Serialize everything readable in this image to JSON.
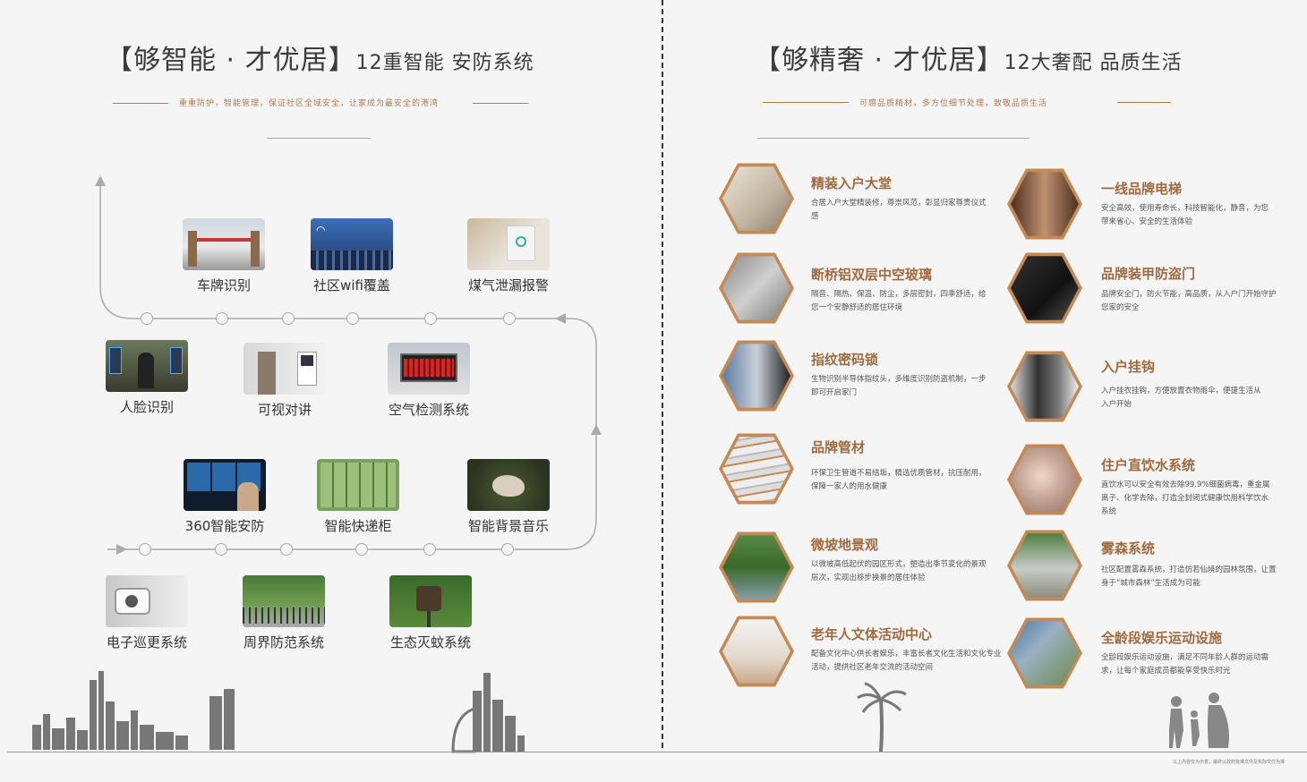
{
  "left": {
    "title_main": "【够智能 · 才优居】",
    "title_sub": "12重智能 安防系统",
    "tagline": "重重防护，智能管理，保证社区全域安全，让家成为最安全的港湾",
    "features": [
      {
        "label": "车牌识别",
        "icon": "license-plate-icon"
      },
      {
        "label": "社区wifi覆盖",
        "icon": "wifi-icon"
      },
      {
        "label": "煤气泄漏报警",
        "icon": "gas-alarm-icon"
      },
      {
        "label": "人脸识别",
        "icon": "face-recognition-icon"
      },
      {
        "label": "可视对讲",
        "icon": "video-intercom-icon"
      },
      {
        "label": "空气检测系统",
        "icon": "air-monitor-icon"
      },
      {
        "label": "360智能安防",
        "icon": "cctv-icon"
      },
      {
        "label": "智能快递柜",
        "icon": "parcel-locker-icon"
      },
      {
        "label": "智能背景音乐",
        "icon": "music-icon"
      },
      {
        "label": "电子巡更系统",
        "icon": "patrol-icon"
      },
      {
        "label": "周界防范系统",
        "icon": "perimeter-icon"
      },
      {
        "label": "生态灭蚊系统",
        "icon": "mosquito-killer-icon"
      }
    ]
  },
  "right": {
    "title_main": "【够精奢 · 才优居】",
    "title_sub": "12大奢配 品质生活",
    "tagline": "可感品质精材，多方位细节处理，致敬品质生活",
    "items": [
      {
        "title": "精装入户大堂",
        "desc": "合居入户大堂精装修，尊崇风范，彰显归家尊贵仪式感"
      },
      {
        "title": "一线品牌电梯",
        "desc": "安全高效，使用寿命长，科技智能化，静音，为您带来省心、安全的生活体验"
      },
      {
        "title": "断桥铝双层中空玻璃",
        "desc": "隔音、隔热、保温、防尘，多层密封，四季舒适，给您一个安静舒适的居住环境"
      },
      {
        "title": "品牌装甲防盗门",
        "desc": "品牌安全门，防火节能，高品质，从入户门开始守护您家的安全"
      },
      {
        "title": "指纹密码锁",
        "desc": "生物识别半导体指纹头，多维度识别防盗机制，一步即可开启家门"
      },
      {
        "title": "入户挂钩",
        "desc": "入户挂衣挂钩，方便放置衣物雨伞，便捷生活从入户开始"
      },
      {
        "title": "品牌管材",
        "desc": "环保卫生管道不易结垢，精选优质管材，抗压耐用，保障一家人的用水健康"
      },
      {
        "title": "住户直饮水系统",
        "desc": "直饮水可以安全有效去除99.9%细菌病毒，重金属离子、化学去除，打造全封闭式健康饮用科学饮水系统"
      },
      {
        "title": "微坡地景观",
        "desc": "以微坡高低起伏的园区形式，塑造出季节变化的景观层次，实现出移步换景的居住体验"
      },
      {
        "title": "雾森系统",
        "desc": "社区配置雾森系统，打造仿若仙境的园林氛围，让置身于“城市森林”生活成为可能"
      },
      {
        "title": "老年人文体活动中心",
        "desc": "配备文化中心供长者娱乐，丰富长者文化生活和文化专业活动，提供社区老年交流的活动空间"
      },
      {
        "title": "全龄段娱乐运动设施",
        "desc": "全龄段娱乐运动设施，满足不同年龄人群的运动需求，让每个家庭成员都能享受快乐时光"
      }
    ],
    "footnote": "以上内容仅为示意，最终以政府批准文件及实际交付为准"
  },
  "colors": {
    "accent": "#b07a4c",
    "hex_border": "#c48a56"
  }
}
